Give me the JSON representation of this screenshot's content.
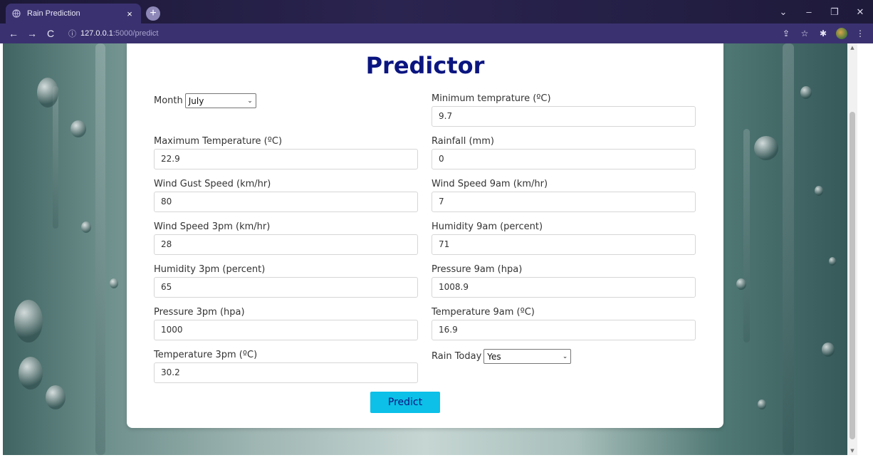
{
  "browser": {
    "tab_title": "Rain Prediction",
    "tab_close": "×",
    "new_tab": "+",
    "url_host": "127.0.0.1",
    "url_path": ":5000/predict",
    "back": "←",
    "forward": "→",
    "reload": "C",
    "info": "ⓘ",
    "window_controls": {
      "dropdown": "⌄",
      "minimize": "–",
      "restore": "❐",
      "close": "✕"
    },
    "toolbar": {
      "share": "⇪",
      "bookmark": "☆",
      "extensions": "✱",
      "menu": "⋮"
    }
  },
  "form": {
    "title": "Predictor",
    "month": {
      "label": "Month",
      "value": "July"
    },
    "min_temp": {
      "label": "Minimum temprature (ºC)",
      "value": "9.7"
    },
    "max_temp": {
      "label": "Maximum Temperature (ºC)",
      "value": "22.9"
    },
    "rainfall": {
      "label": "Rainfall (mm)",
      "value": "0"
    },
    "wind_gust_speed": {
      "label": "Wind Gust Speed (km/hr)",
      "value": "80"
    },
    "wind_speed_9am": {
      "label": "Wind Speed 9am (km/hr)",
      "value": "7"
    },
    "wind_speed_3pm": {
      "label": "Wind Speed 3pm (km/hr)",
      "value": "28"
    },
    "humidity_9am": {
      "label": "Humidity 9am (percent)",
      "value": "71"
    },
    "humidity_3pm": {
      "label": "Humidity 3pm (percent)",
      "value": "65"
    },
    "pressure_9am": {
      "label": "Pressure 9am (hpa)",
      "value": "1008.9"
    },
    "pressure_3pm": {
      "label": "Pressure 3pm (hpa)",
      "value": "1000"
    },
    "temp_9am": {
      "label": "Temperature 9am (ºC)",
      "value": "16.9"
    },
    "temp_3pm": {
      "label": "Temperature 3pm (ºC)",
      "value": "30.2"
    },
    "rain_today": {
      "label": "Rain Today",
      "value": "Yes"
    },
    "submit_label": "Predict"
  },
  "colors": {
    "title": "#0b1580",
    "button": "#0cc0e8",
    "chrome_bg": "#3a3270"
  }
}
